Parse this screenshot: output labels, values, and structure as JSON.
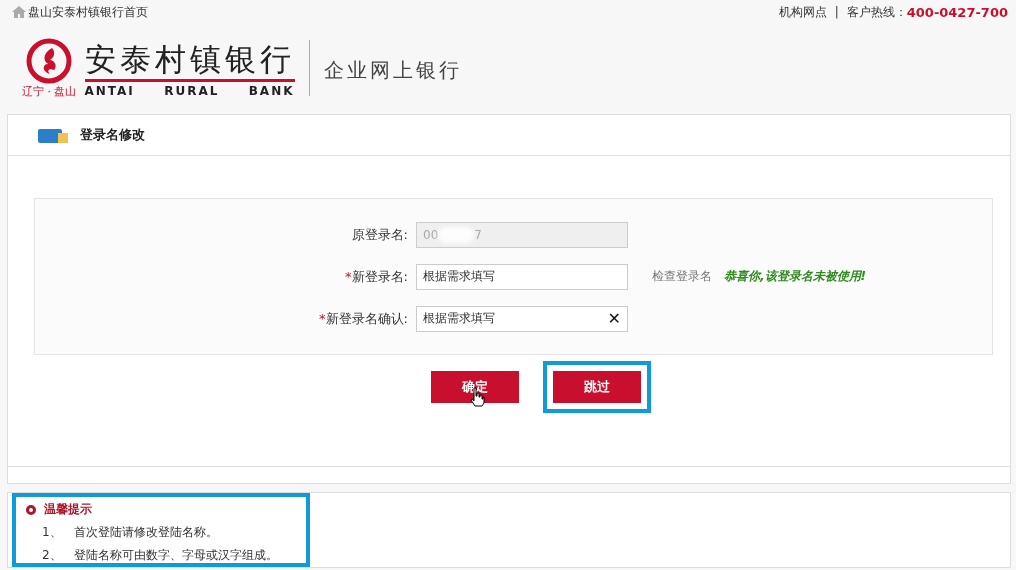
{
  "top_bar": {
    "home_link": "盘山安泰村镇银行首页",
    "branches_link": "机构网点",
    "separator": "|",
    "hotline_label": "客户热线：",
    "hotline_number": "400-0427-700"
  },
  "logo": {
    "region": "辽宁 · 盘山",
    "name_cn": "安泰村镇银行",
    "name_en": [
      "ANTAI",
      "RURAL",
      "BANK"
    ],
    "product": "企业网上银行"
  },
  "panel": {
    "title": "登录名修改"
  },
  "form": {
    "rows": [
      {
        "kind": "readonly",
        "label": "原登录名:",
        "required": false,
        "value_start": "00",
        "value_end": "7"
      },
      {
        "kind": "input",
        "label": "新登录名:",
        "required": true,
        "value": "根据需求填写",
        "check_link": "检查登录名",
        "message": "恭喜你,该登录名未被使用!"
      },
      {
        "kind": "input",
        "label": "新登录名确认:",
        "required": true,
        "value": "根据需求填写",
        "clearable": true,
        "clear_icon": "✕"
      }
    ],
    "required_mark": "*"
  },
  "buttons": [
    {
      "label": "确定",
      "highlighted": false,
      "hovered": true
    },
    {
      "label": "跳过",
      "highlighted": true,
      "hovered": false
    }
  ],
  "tips": {
    "title": "温馨提示",
    "highlighted": true,
    "items": [
      {
        "number": "1、",
        "text": "首次登陆请修改登陆名称。"
      },
      {
        "number": "2、",
        "text": "登陆名称可由数字、字母或汉字组成。"
      }
    ]
  }
}
